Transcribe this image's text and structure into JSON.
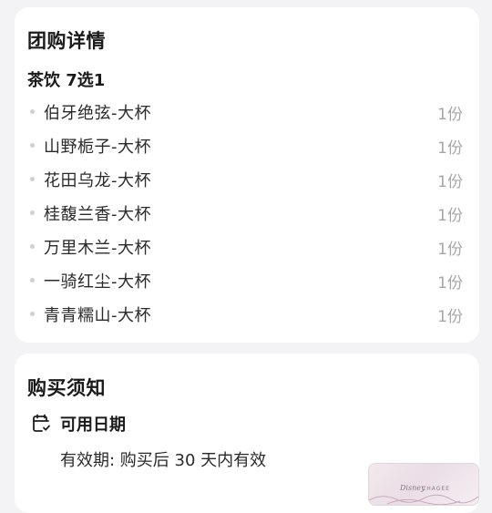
{
  "detail": {
    "title": "团购详情",
    "group_title": "茶饮 7选1",
    "items": [
      {
        "name": "伯牙绝弦-大杯",
        "qty": "1份"
      },
      {
        "name": "山野栀子-大杯",
        "qty": "1份"
      },
      {
        "name": "花田乌龙-大杯",
        "qty": "1份"
      },
      {
        "name": "桂馥兰香-大杯",
        "qty": "1份"
      },
      {
        "name": "万里木兰-大杯",
        "qty": "1份"
      },
      {
        "name": "一骑红尘-大杯",
        "qty": "1份"
      },
      {
        "name": "青青糯山-大杯",
        "qty": "1份"
      }
    ]
  },
  "notice": {
    "title": "购买须知",
    "date_label": "可用日期",
    "date_icon": "calendar-check-icon",
    "validity": "有效期: 购买后 30 天内有效"
  },
  "floating_thumb": {
    "logo": "Disney",
    "brand": "CHAGEE"
  },
  "colors": {
    "page_background": "#f3f3f5",
    "card_background": "#ffffff",
    "text_primary": "#1a1a1a",
    "text_secondary": "#a6a6a6"
  }
}
